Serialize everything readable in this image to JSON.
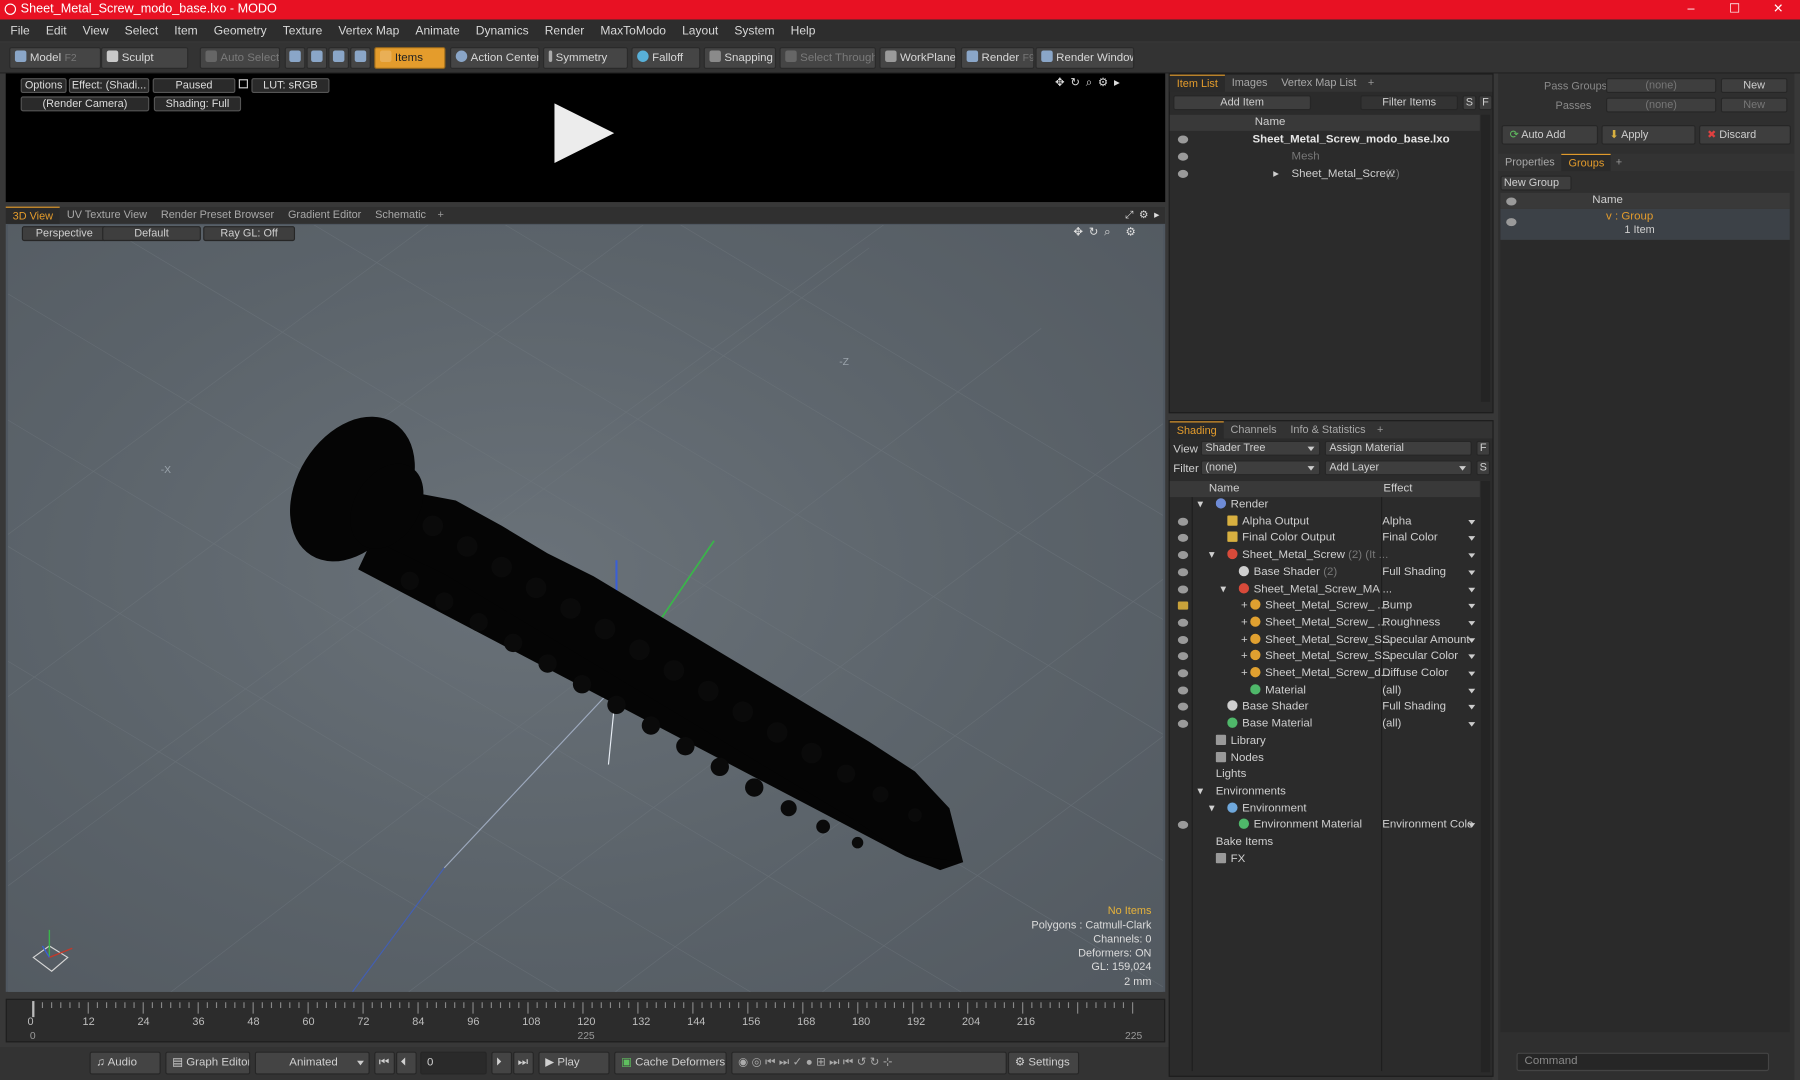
{
  "window": {
    "title": "Sheet_Metal_Screw_modo_base.lxo - MODO",
    "controls": [
      "–",
      "☐",
      "✕"
    ]
  },
  "menu": [
    "File",
    "Edit",
    "View",
    "Select",
    "Item",
    "Geometry",
    "Texture",
    "Vertex Map",
    "Animate",
    "Dynamics",
    "Render",
    "MaxToModo",
    "Layout",
    "System",
    "Help"
  ],
  "toolbar": {
    "model": "Model",
    "model_key": "F2",
    "sculpt": "Sculpt",
    "auto_select": "Auto Select",
    "items": "Items",
    "action_center": "Action Center",
    "symmetry": "Symmetry",
    "falloff": "Falloff",
    "snapping": "Snapping",
    "select_through": "Select Through",
    "workplane": "WorkPlane",
    "render": "Render",
    "render_key": "F9",
    "render_window": "Render Window"
  },
  "preview": {
    "options": "Options",
    "effect": "Effect: (Shadi...",
    "paused": "Paused",
    "lut": "LUT: sRGB",
    "camera": "(Render Camera)",
    "shading": "Shading: Full"
  },
  "viewport": {
    "tabs": [
      "3D View",
      "UV Texture View",
      "Render Preset Browser",
      "Gradient Editor",
      "Schematic"
    ],
    "perspective": "Perspective",
    "default": "Default",
    "raygl": "Ray GL: Off",
    "axis_x": "-X",
    "axis_z": "-Z",
    "hud": {
      "no_items": "No Items",
      "polygons": "Polygons : Catmull-Clark",
      "channels": "Channels: 0",
      "deformers": "Deformers: ON",
      "gl": "GL: 159,024",
      "scale": "2 mm"
    },
    "colors": {
      "x_axis": "#c0392b",
      "y_axis": "#3ab54a",
      "z_axis": "#3a5fd6"
    }
  },
  "timeline": {
    "ticks": [
      "0",
      "12",
      "24",
      "36",
      "48",
      "60",
      "72",
      "84",
      "96",
      "108",
      "120",
      "132",
      "144",
      "156",
      "168",
      "180",
      "192",
      "204",
      "216"
    ],
    "start": "0",
    "mid": "225",
    "end": "225"
  },
  "bottombar": {
    "audio": "Audio",
    "graph_editor": "Graph Editor",
    "animated": "Animated",
    "frame": "0",
    "play": "Play",
    "cache": "Cache Deformers",
    "settings": "Settings"
  },
  "itemlist": {
    "tabs": [
      "Item List",
      "Images",
      "Vertex Map List"
    ],
    "add_item": "Add Item",
    "filter": "Filter Items",
    "s": "S",
    "f": "F",
    "col_name": "Name",
    "rows": [
      {
        "name": "Sheet_Metal_Screw_modo_base.lxo",
        "count": ""
      },
      {
        "name": "Mesh",
        "count": ""
      },
      {
        "name": "Sheet_Metal_Screw",
        "count": "(2)"
      }
    ]
  },
  "shading": {
    "tabs": [
      "Shading",
      "Channels",
      "Info & Statistics"
    ],
    "view_label": "View",
    "view_value": "Shader Tree",
    "assign": "Assign Material",
    "filter_label": "Filter",
    "filter_value": "(none)",
    "add_layer": "Add Layer",
    "f": "F",
    "s": "S",
    "col_name": "Name",
    "col_effect": "Effect",
    "rows": [
      {
        "name": "Render",
        "extra": "",
        "effect": ""
      },
      {
        "name": "Alpha Output",
        "extra": "",
        "effect": "Alpha"
      },
      {
        "name": "Final Color Output",
        "extra": "",
        "effect": "Final Color"
      },
      {
        "name": "Sheet_Metal_Screw",
        "extra": "(2) (It ...",
        "effect": ""
      },
      {
        "name": "Base Shader",
        "extra": "(2)",
        "effect": "Full Shading"
      },
      {
        "name": "Sheet_Metal_Screw_MA ...",
        "extra": "",
        "effect": ""
      },
      {
        "name": "Sheet_Metal_Screw_ ...",
        "extra": "",
        "effect": "Bump"
      },
      {
        "name": "Sheet_Metal_Screw_ ...",
        "extra": "",
        "effect": "Roughness"
      },
      {
        "name": "Sheet_Metal_Screw_S...",
        "extra": "",
        "effect": "Specular Amount"
      },
      {
        "name": "Sheet_Metal_Screw_S...",
        "extra": "",
        "effect": "Specular Color"
      },
      {
        "name": "Sheet_Metal_Screw_d...",
        "extra": "",
        "effect": "Diffuse Color"
      },
      {
        "name": "Material",
        "extra": "",
        "effect": "(all)"
      },
      {
        "name": "Base Shader",
        "extra": "",
        "effect": "Full Shading"
      },
      {
        "name": "Base Material",
        "extra": "",
        "effect": "(all)"
      },
      {
        "name": "Library",
        "extra": "",
        "effect": ""
      },
      {
        "name": "Nodes",
        "extra": "",
        "effect": ""
      },
      {
        "name": "Lights",
        "extra": "",
        "effect": ""
      },
      {
        "name": "Environments",
        "extra": "",
        "effect": ""
      },
      {
        "name": "Environment",
        "extra": "",
        "effect": ""
      },
      {
        "name": "Environment Material",
        "extra": "",
        "effect": "Environment Color"
      },
      {
        "name": "Bake Items",
        "extra": "",
        "effect": ""
      },
      {
        "name": "FX",
        "extra": "",
        "effect": ""
      }
    ]
  },
  "groups": {
    "pass_groups": "Pass Groups",
    "pass_groups_val": "(none)",
    "new": "New",
    "passes": "Passes",
    "passes_val": "(none)",
    "new2": "New",
    "auto_add": "Auto Add",
    "apply": "Apply",
    "discard": "Discard",
    "tabs": [
      "Properties",
      "Groups"
    ],
    "new_group": "New Group",
    "col_name": "Name",
    "group_name": "v : Group",
    "group_items": "1 Item",
    "command": "Command"
  }
}
